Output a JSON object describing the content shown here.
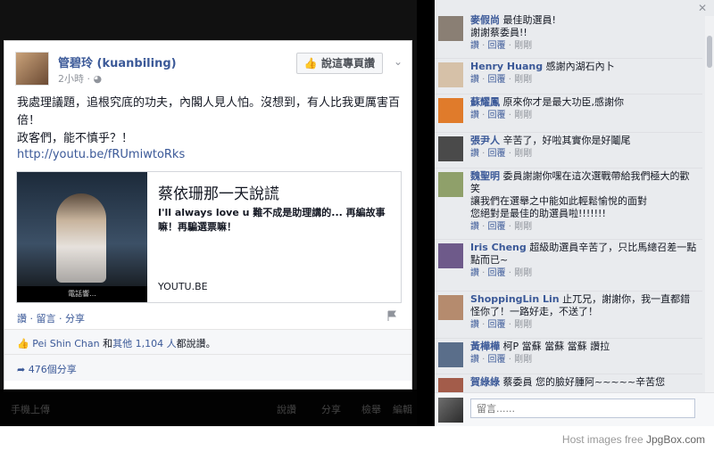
{
  "post": {
    "author": "管碧玲 (kuanbiling)",
    "time": "2小時 · ",
    "follow_label": "說這專頁讚",
    "text_line1": "我處理議題，追根究底的功夫，內閣人見人怕。沒想到，有人比我更厲害百倍！",
    "text_line2": "政客們，能不慎乎？！",
    "link": "http://youtu.be/fRUmiwtoRks",
    "share": {
      "title": "蔡依珊那一天說謊",
      "desc": "I'll always love u 難不成是助理講的... 再編故事嘛！再騙選票嘛！",
      "domain": "YOUTU.BE",
      "thumb_caption": "電話響..."
    },
    "actions": "讚 · 留言 · 分享",
    "likes_name": "Pei Shin Chan",
    "likes_and": " 和",
    "likes_others": "其他 1,104 人",
    "likes_suffix": "都說讚。",
    "shares": "476個分享"
  },
  "bottom_strip": [
    "手機上傳",
    "說讚",
    "分享",
    "檢舉",
    "編輯"
  ],
  "comments": [
    {
      "name": "麥假尚",
      "text": "最佳助選員!\n謝謝蔡委員!!",
      "meta": [
        "讚",
        "回覆",
        "剛剛"
      ]
    },
    {
      "name": "Henry Huang",
      "text": "感謝內湖石內卜",
      "meta": [
        "讚",
        "回覆",
        "剛剛"
      ]
    },
    {
      "name": "蘇耀鳳",
      "text": "原來你才是最大功臣,感謝你",
      "meta": [
        "讚",
        "回覆",
        "剛剛"
      ]
    },
    {
      "name": "張尹人",
      "text": "辛苦了，好啦其實你是好鬮尾",
      "meta": [
        "讚",
        "回覆",
        "剛剛"
      ]
    },
    {
      "name": "魏聖明",
      "text": "委員謝謝你嘿在這次選戰帶給我們極大的歡笑\n讓我們在選舉之中能如此輕鬆愉悅的面對\n您絕對是最佳的助選員啦!!!!!!!",
      "meta": [
        "讚",
        "回覆",
        "剛剛"
      ]
    },
    {
      "name": "Iris Cheng",
      "text": "超級助選員辛苦了，只比馬總召差一點點而已~",
      "meta": [
        "讚",
        "回覆",
        "剛剛"
      ]
    },
    {
      "name": "ShoppingLin Lin",
      "text": "止兀兄，謝謝你，我一直都錯怪你了！一路好走，不送了！",
      "meta": [
        "讚",
        "回覆",
        "剛剛"
      ]
    },
    {
      "name": "黃樺樺",
      "text": "柯P 當蘇 當蘇 當蘇 讚拉",
      "meta": [
        "讚",
        "回覆",
        "剛剛"
      ]
    },
    {
      "name": "賀綠綠",
      "text": "蔡委員 您的臉好腫阿~~~~~辛苦您",
      "meta": []
    }
  ],
  "composer_placeholder": "留言......",
  "footer_prefix": "Host images free ",
  "footer_brand": "JpgBox.com"
}
